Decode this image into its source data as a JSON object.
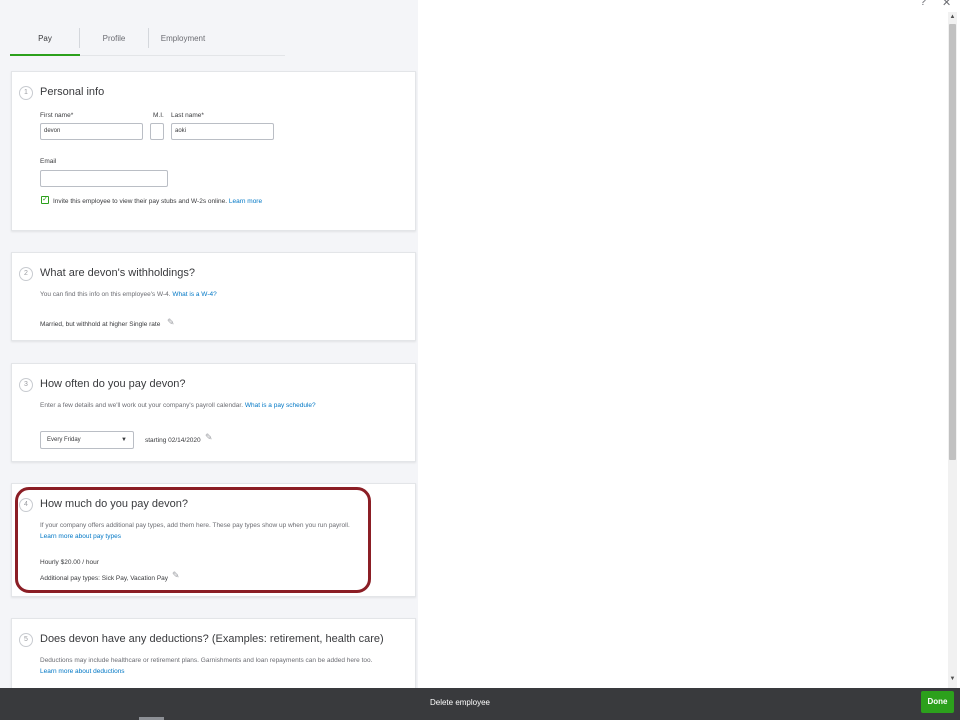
{
  "tabs": [
    {
      "label": "Pay",
      "active": true
    },
    {
      "label": "Profile",
      "active": false
    },
    {
      "label": "Employment",
      "active": false
    }
  ],
  "personal_info": {
    "step": "1",
    "title": "Personal info",
    "first_name_label": "First name*",
    "first_name_value": "devon",
    "mi_label": "M.I.",
    "mi_value": "",
    "last_name_label": "Last name*",
    "last_name_value": "aoki",
    "email_label": "Email",
    "email_value": "",
    "invite_checked": true,
    "invite_text": "Invite this employee to view their pay stubs and W-2s online.",
    "learn_more": "Learn more"
  },
  "withholdings": {
    "step": "2",
    "title": "What are devon's withholdings?",
    "desc": "You can find this info on this employee's W-4.",
    "desc_link": "What is a W-4?",
    "value": "Married, but withhold at higher Single rate"
  },
  "pay_schedule": {
    "step": "3",
    "title": "How often do you pay devon?",
    "desc": "Enter a few details and we'll work out your company's payroll calendar.",
    "desc_link": "What is a pay schedule?",
    "frequency": "Every Friday",
    "starting": "starting 02/14/2020"
  },
  "pay_rate": {
    "step": "4",
    "title": "How much do you pay devon?",
    "desc": "If your company offers additional pay types, add them here. These pay types show up when you run payroll.",
    "desc_link": "Learn more about pay types",
    "rate": "Hourly $20.00 / hour",
    "additional": "Additional pay types: Sick Pay, Vacation Pay"
  },
  "deductions": {
    "step": "5",
    "title": "Does devon have any deductions? (Examples: retirement, health care)",
    "desc": "Deductions may include healthcare or retirement plans. Garnishments and loan repayments can be added here too.",
    "desc_link": "Learn more about deductions"
  },
  "icons": {
    "help": "?",
    "close": "✕",
    "pencil": "✎",
    "check": "✓",
    "caret": "▼",
    "scroll_up": "▲",
    "scroll_down": "▼"
  },
  "footer": {
    "delete_label": "Delete employee",
    "done_label": "Done"
  },
  "colors": {
    "accent": "#2ca01c",
    "link": "#0077c5",
    "highlight": "#8b1e25",
    "footer": "#393a3d"
  }
}
